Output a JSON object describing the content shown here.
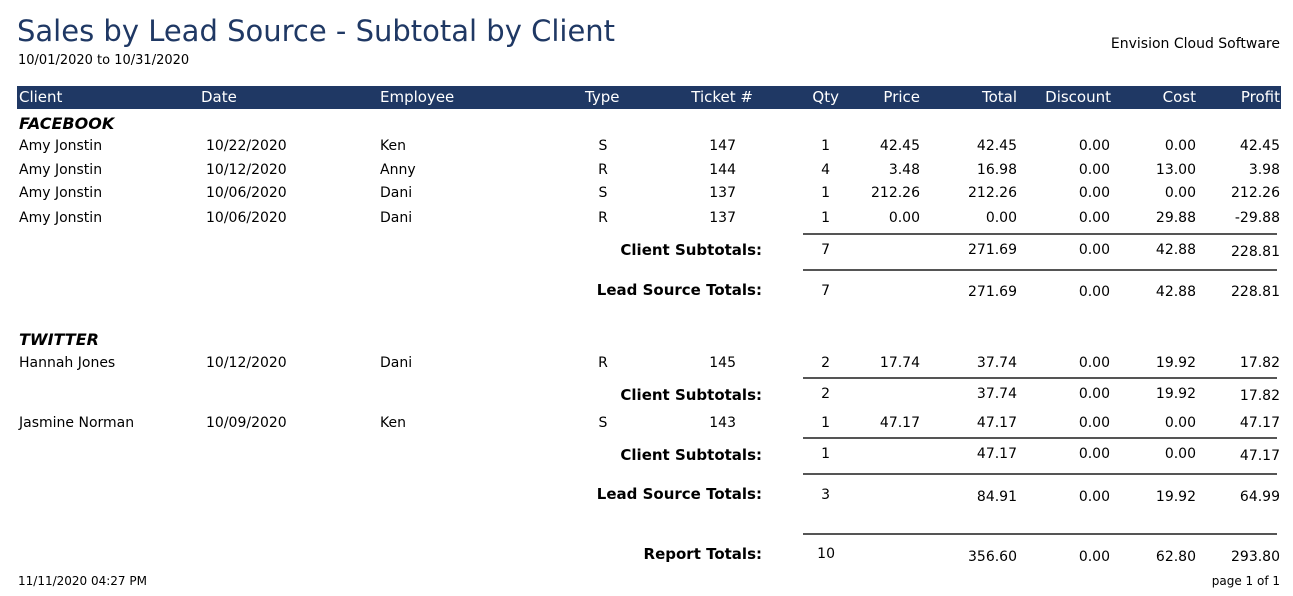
{
  "header": {
    "title": "Sales by Lead Source - Subtotal by Client",
    "date_range": "10/01/2020 to 10/31/2020",
    "company": "Envision Cloud Software"
  },
  "columns": {
    "client": "Client",
    "date": "Date",
    "employee": "Employee",
    "type": "Type",
    "ticket": "Ticket #",
    "qty": "Qty",
    "price": "Price",
    "total": "Total",
    "discount": "Discount",
    "cost": "Cost",
    "profit": "Profit"
  },
  "labels": {
    "client_subtotals": "Client Subtotals:",
    "lead_source_totals": "Lead Source  Totals:",
    "report_totals": "Report Totals:"
  },
  "groups": [
    {
      "name": "FACEBOOK",
      "rows": [
        {
          "client": "Amy Jonstin",
          "date": "10/22/2020",
          "employee": "Ken",
          "type": "S",
          "ticket": "147",
          "qty": "1",
          "price": "42.45",
          "total": "42.45",
          "discount": "0.00",
          "cost": "0.00",
          "profit": "42.45"
        },
        {
          "client": "Amy Jonstin",
          "date": "10/12/2020",
          "employee": "Anny",
          "type": "R",
          "ticket": "144",
          "qty": "4",
          "price": "3.48",
          "total": "16.98",
          "discount": "0.00",
          "cost": "13.00",
          "profit": "3.98"
        },
        {
          "client": "Amy Jonstin",
          "date": "10/06/2020",
          "employee": "Dani",
          "type": "S",
          "ticket": "137",
          "qty": "1",
          "price": "212.26",
          "total": "212.26",
          "discount": "0.00",
          "cost": "0.00",
          "profit": "212.26"
        },
        {
          "client": "Amy Jonstin",
          "date": "10/06/2020",
          "employee": "Dani",
          "type": "R",
          "ticket": "137",
          "qty": "1",
          "price": "0.00",
          "total": "0.00",
          "discount": "0.00",
          "cost": "29.88",
          "profit": "-29.88"
        }
      ],
      "client_subtotals": [
        {
          "qty": "7",
          "total": "271.69",
          "discount": "0.00",
          "cost": "42.88",
          "profit": "228.81"
        }
      ],
      "lead_totals": {
        "qty": "7",
        "total": "271.69",
        "discount": "0.00",
        "cost": "42.88",
        "profit": "228.81"
      }
    },
    {
      "name": "TWITTER",
      "rows": [
        {
          "client": "Hannah Jones",
          "date": "10/12/2020",
          "employee": "Dani",
          "type": "R",
          "ticket": "145",
          "qty": "2",
          "price": "17.74",
          "total": "37.74",
          "discount": "0.00",
          "cost": "19.92",
          "profit": "17.82"
        },
        {
          "client": "Jasmine Norman",
          "date": "10/09/2020",
          "employee": "Ken",
          "type": "S",
          "ticket": "143",
          "qty": "1",
          "price": "47.17",
          "total": "47.17",
          "discount": "0.00",
          "cost": "0.00",
          "profit": "47.17"
        }
      ],
      "client_subtotals": [
        {
          "qty": "2",
          "total": "37.74",
          "discount": "0.00",
          "cost": "19.92",
          "profit": "17.82"
        },
        {
          "qty": "1",
          "total": "47.17",
          "discount": "0.00",
          "cost": "0.00",
          "profit": "47.17"
        }
      ],
      "lead_totals": {
        "qty": "3",
        "total": "84.91",
        "discount": "0.00",
        "cost": "19.92",
        "profit": "64.99"
      }
    }
  ],
  "report_totals": {
    "qty": "10",
    "total": "356.60",
    "discount": "0.00",
    "cost": "62.80",
    "profit": "293.80"
  },
  "footer": {
    "timestamp": "11/11/2020 04:27 PM",
    "page": "page 1 of 1"
  }
}
